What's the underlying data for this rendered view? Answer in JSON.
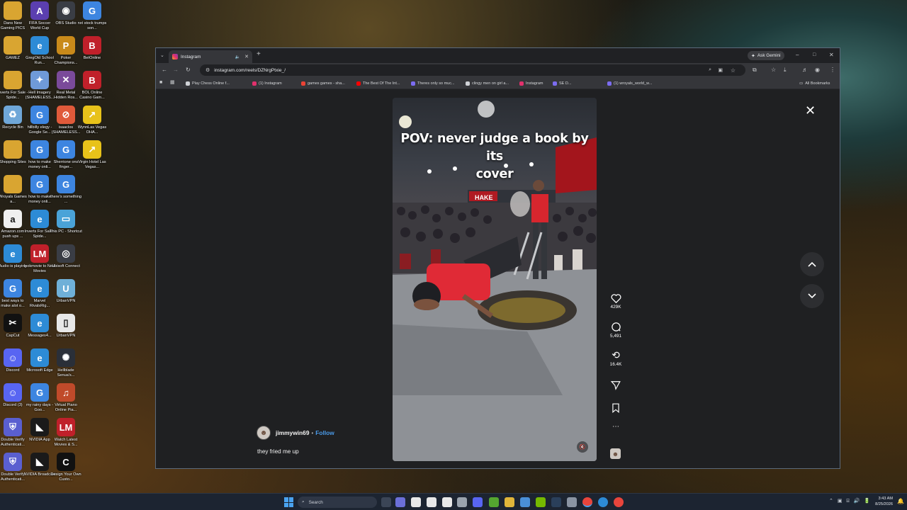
{
  "desktop": {
    "icons": [
      {
        "label": "Dans New Gaming PICS",
        "color": "#d9a531",
        "glyph": "",
        "col": 0,
        "row": 0
      },
      {
        "label": "FIFA Soccer World Cup",
        "color": "#5b3fb0",
        "glyph": "A",
        "col": 1,
        "row": 0
      },
      {
        "label": "OBS Studio",
        "color": "#3a3d45",
        "glyph": "◉",
        "col": 2,
        "row": 0
      },
      {
        "label": "nxt stock trumps son...",
        "color": "#3d85e0",
        "glyph": "G",
        "col": 3,
        "row": 0
      },
      {
        "label": "GAMEZ",
        "color": "#d9a531",
        "glyph": "",
        "col": 0,
        "row": 1
      },
      {
        "label": "GregOld School Run...",
        "color": "#2d8bd6",
        "glyph": "e",
        "col": 1,
        "row": 1
      },
      {
        "label": "Poker Champions...",
        "color": "#c98a1a",
        "glyph": "P",
        "col": 2,
        "row": 1
      },
      {
        "label": "BetOnline",
        "color": "#c0202a",
        "glyph": "B",
        "col": 3,
        "row": 1
      },
      {
        "label": "Inverts For Sale - Spide...",
        "color": "#d9a531",
        "glyph": "",
        "col": 0,
        "row": 2
      },
      {
        "label": "Hell Imagery (SHAMELESS...",
        "color": "#6f9ad8",
        "glyph": "✦",
        "col": 1,
        "row": 2
      },
      {
        "label": "Real Metal Hidden Ros...",
        "color": "#7a4a9a",
        "glyph": "✕",
        "col": 2,
        "row": 2
      },
      {
        "label": "BOL Online Casino Gam...",
        "color": "#c0202a",
        "glyph": "B",
        "col": 3,
        "row": 2
      },
      {
        "label": "Recycle Bin",
        "color": "#6fa7d8",
        "glyph": "♻",
        "col": 0,
        "row": 3
      },
      {
        "label": "hillbilly elegy - Google Se...",
        "color": "#3d85e0",
        "glyph": "G",
        "col": 1,
        "row": 3
      },
      {
        "label": "isaaclos (SHAMELESS...",
        "color": "#e05a3a",
        "glyph": "⊘",
        "col": 2,
        "row": 3
      },
      {
        "label": "WynnLas Vegas OHA...",
        "color": "#e8c21a",
        "glyph": "↗",
        "col": 3,
        "row": 3
      },
      {
        "label": "Shopping Sites",
        "color": "#d9a531",
        "glyph": "",
        "col": 0,
        "row": 4
      },
      {
        "label": "how to make money onli...",
        "color": "#3d85e0",
        "glyph": "G",
        "col": 1,
        "row": 4
      },
      {
        "label": "Sherrione ons finger...",
        "color": "#3d85e0",
        "glyph": "G",
        "col": 2,
        "row": 4
      },
      {
        "label": "Virgin Hotel Las Vegas...",
        "color": "#e8c21a",
        "glyph": "↗",
        "col": 3,
        "row": 4
      },
      {
        "label": "Wroyals Games a...",
        "color": "#d9a531",
        "glyph": "",
        "col": 0,
        "row": 5
      },
      {
        "label": "how to make money onli...",
        "color": "#3d85e0",
        "glyph": "G",
        "col": 1,
        "row": 5
      },
      {
        "label": "there's something ...",
        "color": "#3d85e0",
        "glyph": "G",
        "col": 2,
        "row": 5
      },
      {
        "label": "Amazon.com push ups ...",
        "color": "#f0f0f0",
        "glyph": "a",
        "col": 0,
        "row": 6
      },
      {
        "label": "Inverts For Sale - Spide...",
        "color": "#2d8bd6",
        "glyph": "e",
        "col": 1,
        "row": 6
      },
      {
        "label": "This PC - Shortcut",
        "color": "#4aa3d8",
        "glyph": "▭",
        "col": 2,
        "row": 6
      },
      {
        "label": "Audio is playing",
        "color": "#2d8bd6",
        "glyph": "e",
        "col": 0,
        "row": 7
      },
      {
        "label": "lookmovie to New Movies",
        "color": "#c0202a",
        "glyph": "LM",
        "col": 1,
        "row": 7
      },
      {
        "label": "Ubisoft Connect",
        "color": "#3a3d45",
        "glyph": "◎",
        "col": 2,
        "row": 7
      },
      {
        "label": "best ways to make alot o...",
        "color": "#3d85e0",
        "glyph": "G",
        "col": 0,
        "row": 8
      },
      {
        "label": "Marvel RivalsRig...",
        "color": "#2d8bd6",
        "glyph": "e",
        "col": 1,
        "row": 8
      },
      {
        "label": "UrbanVPN",
        "color": "#6fb0d8",
        "glyph": "U",
        "col": 2,
        "row": 8
      },
      {
        "label": "CapCut",
        "color": "#111111",
        "glyph": "✂",
        "col": 0,
        "row": 9
      },
      {
        "label": "Messages4...",
        "color": "#2d8bd6",
        "glyph": "e",
        "col": 1,
        "row": 9
      },
      {
        "label": "UrbanVPN",
        "color": "#e8e8e8",
        "glyph": "▯",
        "col": 2,
        "row": 9
      },
      {
        "label": "Discord",
        "color": "#5865f2",
        "glyph": "☺",
        "col": 0,
        "row": 10
      },
      {
        "label": "Microsoft Edge",
        "color": "#2d8bd6",
        "glyph": "e",
        "col": 1,
        "row": 10
      },
      {
        "label": "Hellblade Senua's...",
        "color": "#2a2f38",
        "glyph": "✺",
        "col": 2,
        "row": 10
      },
      {
        "label": "Discord (3)",
        "color": "#5865f2",
        "glyph": "☺",
        "col": 0,
        "row": 11
      },
      {
        "label": "my rainy days - Goo...",
        "color": "#3d85e0",
        "glyph": "G",
        "col": 1,
        "row": 11
      },
      {
        "label": "Virtual Piano Online Pia...",
        "color": "#c04a2a",
        "glyph": "♫",
        "col": 2,
        "row": 11
      },
      {
        "label": "Double Verify Authenticati...",
        "color": "#5a5fd0",
        "glyph": "⛨",
        "col": 0,
        "row": 12
      },
      {
        "label": "NVIDIA App",
        "color": "#1a1a1a",
        "glyph": "◣",
        "col": 1,
        "row": 12
      },
      {
        "label": "Watch Latest Movies & S...",
        "color": "#c0202a",
        "glyph": "LM",
        "col": 2,
        "row": 12
      },
      {
        "label": "Double Verify Authenticati...",
        "color": "#5a5fd0",
        "glyph": "⛨",
        "col": 0,
        "row": 13
      },
      {
        "label": "NVIDIA Broadcast",
        "color": "#1a1a1a",
        "glyph": "◣",
        "col": 1,
        "row": 13
      },
      {
        "label": "Design Your Own Custo...",
        "color": "#111111",
        "glyph": "C",
        "col": 2,
        "row": 13
      }
    ]
  },
  "browser": {
    "tab_title": "Instagram",
    "new_tab": "+",
    "ask_gemini": "Ask Gemini",
    "url": "instagram.com/reels/DZNrgPtxie_/",
    "bookmarks": [
      {
        "label": "Play Chess Online f...",
        "color": "#cfd2d6"
      },
      {
        "label": "(1) Instagram",
        "color": "#e1306c"
      },
      {
        "label": "games games - sha...",
        "color": "#ea4335"
      },
      {
        "label": "The Best Of The Int...",
        "color": "#ff0000"
      },
      {
        "label": "Theres only so muc...",
        "color": "#7c6cf0"
      },
      {
        "label": "clingy men on girl a...",
        "color": "#cfd2d6"
      },
      {
        "label": "Instagram",
        "color": "#e1306c"
      },
      {
        "label": "SE D...",
        "color": "#7c6cf0"
      },
      {
        "label": "(1) wroyals_world_w...",
        "color": "#7c6cf0"
      }
    ],
    "all_bookmarks": "All Bookmarks"
  },
  "reel": {
    "caption_line1": "POV: never judge a book by its",
    "caption_line2": "cover",
    "username": "jimmywin69",
    "separator": "•",
    "follow": "Follow",
    "description": "they fried me up",
    "likes": "429K",
    "comments": "5,491",
    "reposts": "16.4K",
    "banner_text": "HAKE"
  },
  "taskbar": {
    "search_placeholder": "Search",
    "time": "3:43 AM",
    "date": "8/25/2026"
  }
}
